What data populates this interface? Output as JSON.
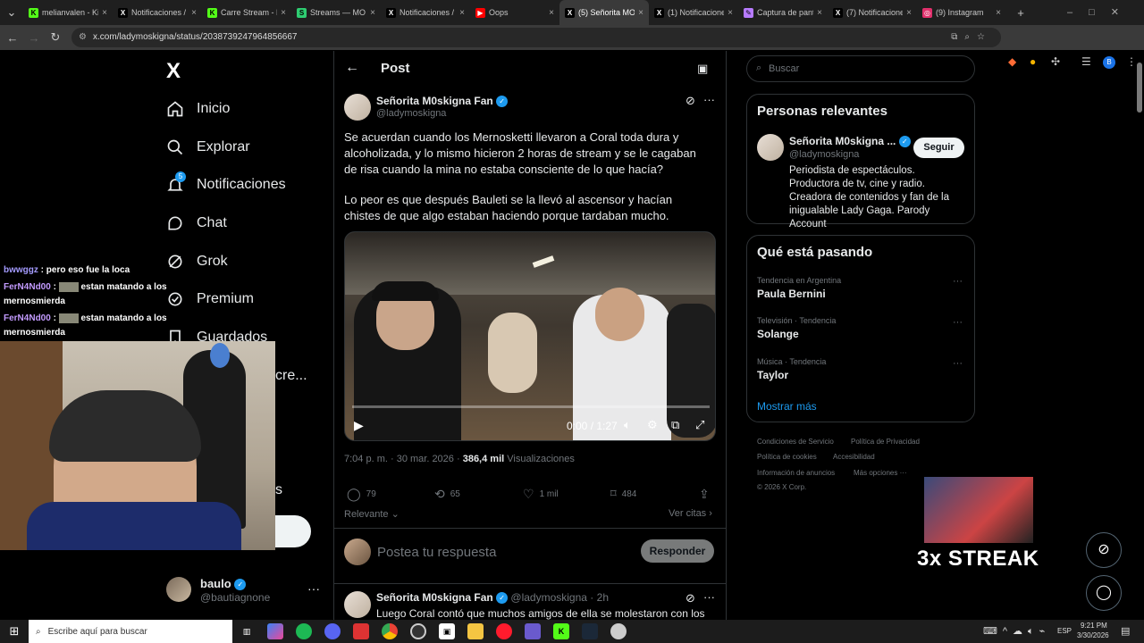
{
  "browser": {
    "tabs": [
      {
        "title": "melianvalen - Kick",
        "fav_color": "#53fc18",
        "fav": "K"
      },
      {
        "title": "Notificaciones / X",
        "fav_color": "#ffffff",
        "fav": "X"
      },
      {
        "title": "Carre Stream - Kick",
        "fav_color": "#53fc18",
        "fav": "K"
      },
      {
        "title": "Streams — MO",
        "fav_color": "#2ecc71",
        "fav": "S"
      },
      {
        "title": "Notificaciones / X",
        "fav_color": "#ffffff",
        "fav": "X"
      },
      {
        "title": "Oops",
        "fav_color": "#ff0000",
        "fav": "▶"
      },
      {
        "title": "(5) Señorita MOs",
        "fav_color": "#ffffff",
        "fav": "X"
      },
      {
        "title": "(1) Notificaciones",
        "fav_color": "#ffffff",
        "fav": "X"
      },
      {
        "title": "Captura de pantalla",
        "fav_color": "#b77bff",
        "fav": "✎"
      },
      {
        "title": "(7) Notificaciones",
        "fav_color": "#ffffff",
        "fav": "X"
      },
      {
        "title": "(9) Instagram",
        "fav_color": "#e1306c",
        "fav": "◎"
      }
    ],
    "url": "x.com/ladymoskigna/status/2038739247964856667"
  },
  "sidebar": {
    "logo": "X",
    "items": [
      {
        "label": "Inicio",
        "icon": "home-icon"
      },
      {
        "label": "Explorar",
        "icon": "search-icon"
      },
      {
        "label": "Notificaciones",
        "icon": "bell-icon",
        "badge": "5"
      },
      {
        "label": "Chat",
        "icon": "chat-icon"
      },
      {
        "label": "Grok",
        "icon": "grok-icon"
      },
      {
        "label": "Premium",
        "icon": "premium-icon"
      },
      {
        "label": "Guardados",
        "icon": "bookmark-icon"
      }
    ],
    "partial_label": "cre...",
    "partial_label2": "s",
    "account": {
      "name": "baulo",
      "handle": "@bautiagnone"
    }
  },
  "stream_overlay": {
    "chat": [
      {
        "user": "bwwggz",
        "text": "pero eso fue la loca"
      },
      {
        "user": "FerN4Nd00",
        "text": "estan matando a los mernosmierda"
      },
      {
        "user": "FerN4Nd00",
        "text": "estan matando a los mernosmierda"
      }
    ],
    "streak": "3x STREAK"
  },
  "post": {
    "header": "Post",
    "author": {
      "name": "Señorita M0skigna Fan",
      "handle": "@ladymoskigna"
    },
    "text1": "Se acuerdan cuando los Mernosketti llevaron a Coral toda dura y alcoholizada, y lo mismo hicieron 2 horas de stream y se le cagaban de risa cuando la mina no estaba consciente de lo que hacía?",
    "text2": "Lo peor es que después Bauleti se la llevó al ascensor y hacían chistes de que algo estaban haciendo porque tardaban mucho.",
    "video": {
      "time": "0:00 / 1:27",
      "progress": 0
    },
    "meta": {
      "time": "7:04 p. m.",
      "date": "30 mar. 2026",
      "views": "386,4 mil",
      "views_label": "Visualizaciones"
    },
    "actions": {
      "replies": "79",
      "reposts": "65",
      "likes": "1 mil",
      "bookmarks": "484"
    },
    "relevant": "Relevante",
    "quotes": "Ver citas",
    "reply_placeholder": "Postea tu respuesta",
    "reply_button": "Responder",
    "reply": {
      "name": "Señorita M0skigna Fan",
      "handle": "@ladymoskigna",
      "age": "2h",
      "text": "Luego Coral contó que muchos amigos de ella se molestaron con los"
    }
  },
  "right": {
    "search_placeholder": "Buscar",
    "relevant_title": "Personas relevantes",
    "person": {
      "name": "Señorita M0skigna ...",
      "handle": "@ladymoskigna",
      "follow": "Seguir",
      "bio": "Periodista de espectáculos. Productora de tv, cine y radio. Creadora de contenidos y fan de la inigualable Lady Gaga. Parody Account"
    },
    "trends_title": "Qué está pasando",
    "trends": [
      {
        "context": "Tendencia en Argentina",
        "name": "Paula Bernini"
      },
      {
        "context": "Televisión · Tendencia",
        "name": "Solange"
      },
      {
        "context": "Música · Tendencia",
        "name": "Taylor"
      }
    ],
    "show_more": "Mostrar más",
    "footer": {
      "terms": "Condiciones de Servicio",
      "privacy": "Política de Privacidad",
      "cookies": "Política de cookies",
      "accessibility": "Accesibilidad",
      "ads": "Información de anuncios",
      "more": "Más opciones ···",
      "copyright": "© 2026 X Corp."
    }
  },
  "taskbar": {
    "search_placeholder": "Escribe aquí para buscar",
    "lang": "ESP",
    "time": "9:21 PM",
    "date": "3/30/2026"
  },
  "colors": {
    "accent": "#1d9bf0",
    "background": "#000000",
    "border": "#2f3336",
    "muted": "#71767b"
  }
}
